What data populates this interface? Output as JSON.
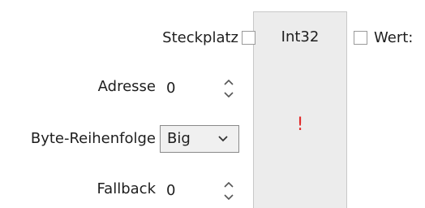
{
  "node": {
    "title": "Int32",
    "error_mark": "!"
  },
  "inputs": {
    "slot_label": "Steckplatz",
    "address_label": "Adresse",
    "address_value": "0",
    "byte_order_label": "Byte-Reihenfolge",
    "byte_order_value": "Big",
    "fallback_label": "Fallback",
    "fallback_value": "0"
  },
  "outputs": {
    "value_label": "Wert:"
  },
  "colors": {
    "node_bg": "#ececec",
    "error": "#e12b2b"
  },
  "icons": {
    "stepper": "up-down-arrows-icon",
    "dropdown": "chevron-down-icon"
  }
}
